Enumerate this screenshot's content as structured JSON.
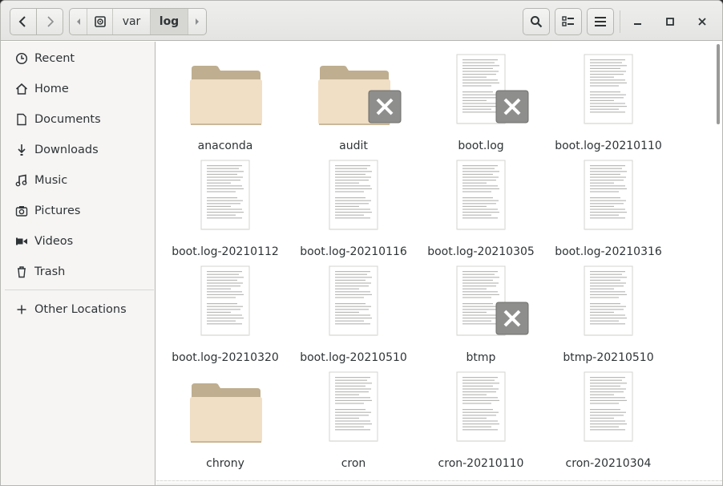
{
  "header": {
    "path": [
      "var",
      "log"
    ]
  },
  "sidebar": {
    "items": [
      {
        "label": "Recent",
        "icon": "clock-icon"
      },
      {
        "label": "Home",
        "icon": "home-icon"
      },
      {
        "label": "Documents",
        "icon": "document-icon"
      },
      {
        "label": "Downloads",
        "icon": "download-icon"
      },
      {
        "label": "Music",
        "icon": "music-icon"
      },
      {
        "label": "Pictures",
        "icon": "camera-icon"
      },
      {
        "label": "Videos",
        "icon": "video-icon"
      },
      {
        "label": "Trash",
        "icon": "trash-icon"
      },
      {
        "label": "Other Locations",
        "icon": "plus-icon"
      }
    ]
  },
  "files": [
    {
      "name": "anaconda",
      "kind": "folder",
      "locked": false
    },
    {
      "name": "audit",
      "kind": "folder",
      "locked": true
    },
    {
      "name": "boot.log",
      "kind": "file",
      "locked": true
    },
    {
      "name": "boot.log-20210110",
      "kind": "file",
      "locked": false
    },
    {
      "name": "boot.log-20210112",
      "kind": "file",
      "locked": false
    },
    {
      "name": "boot.log-20210116",
      "kind": "file",
      "locked": false
    },
    {
      "name": "boot.log-20210305",
      "kind": "file",
      "locked": false
    },
    {
      "name": "boot.log-20210316",
      "kind": "file",
      "locked": false
    },
    {
      "name": "boot.log-20210320",
      "kind": "file",
      "locked": false
    },
    {
      "name": "boot.log-20210510",
      "kind": "file",
      "locked": false
    },
    {
      "name": "btmp",
      "kind": "file",
      "locked": true
    },
    {
      "name": "btmp-20210510",
      "kind": "file",
      "locked": false
    },
    {
      "name": "chrony",
      "kind": "folder",
      "locked": false
    },
    {
      "name": "cron",
      "kind": "file",
      "locked": false
    },
    {
      "name": "cron-20210110",
      "kind": "file",
      "locked": false
    },
    {
      "name": "cron-20210304",
      "kind": "file",
      "locked": false
    }
  ],
  "colors": {
    "folder_tab": "#bfae8f",
    "folder_front": "#f0dfc4",
    "emblem": "#8e8e8c"
  }
}
